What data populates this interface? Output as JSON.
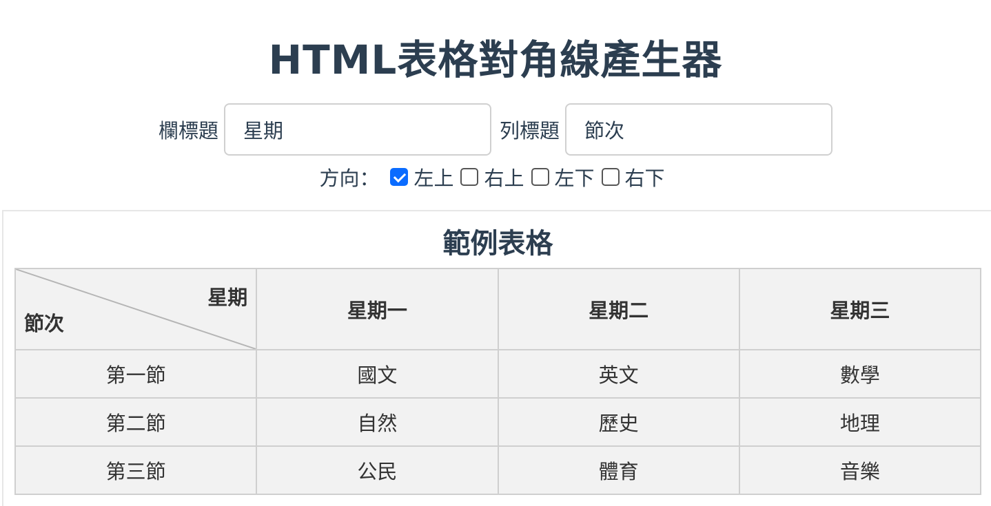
{
  "title": "HTML表格對角線產生器",
  "form": {
    "col_label": "欄標題",
    "col_value": "星期",
    "row_label": "列標題",
    "row_value": "節次"
  },
  "direction": {
    "label": "方向：",
    "options": [
      {
        "label": "左上",
        "checked": true
      },
      {
        "label": "右上",
        "checked": false
      },
      {
        "label": "左下",
        "checked": false
      },
      {
        "label": "右下",
        "checked": false
      }
    ]
  },
  "example": {
    "title": "範例表格",
    "corner_col": "星期",
    "corner_row": "節次",
    "headers": [
      "星期一",
      "星期二",
      "星期三"
    ],
    "rows": [
      [
        "第一節",
        "國文",
        "英文",
        "數學"
      ],
      [
        "第二節",
        "自然",
        "歷史",
        "地理"
      ],
      [
        "第三節",
        "公民",
        "體育",
        "音樂"
      ]
    ]
  }
}
